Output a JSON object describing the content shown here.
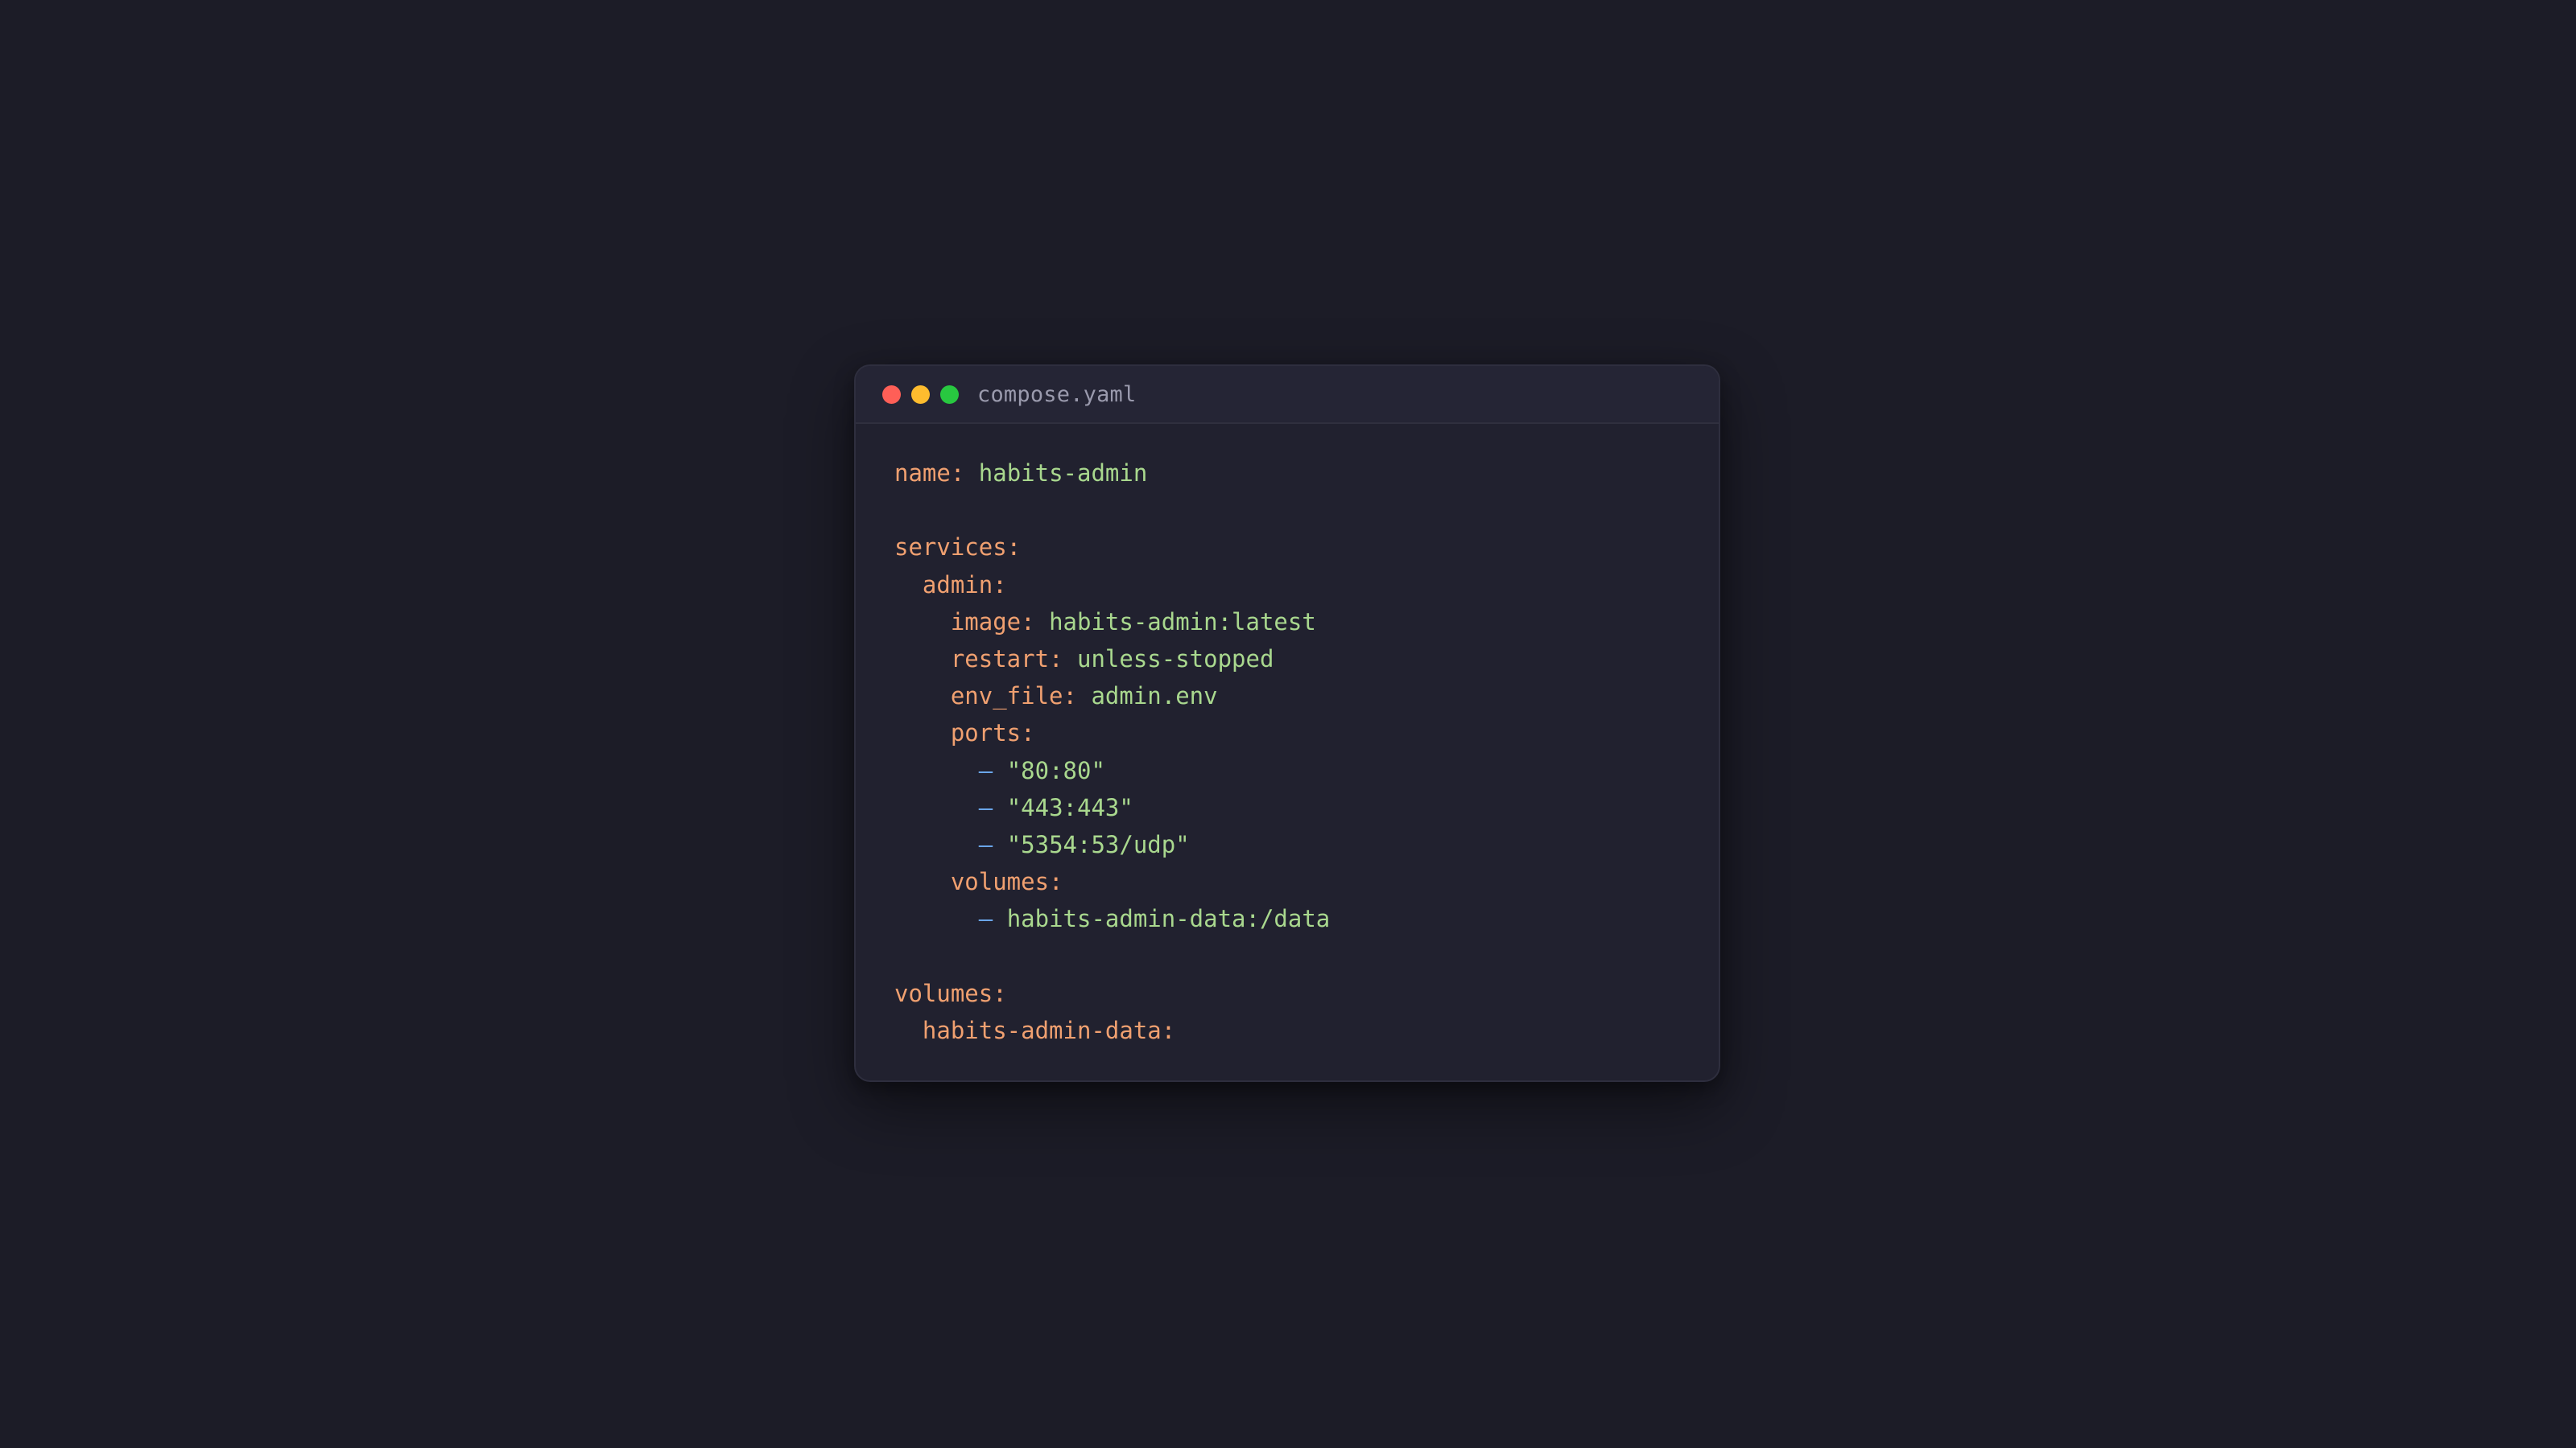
{
  "window": {
    "filename": "compose.yaml",
    "colors": {
      "background": "#1c1c27",
      "window_bg": "#21212f",
      "key": "#f0a070",
      "value": "#a9d88e",
      "dash": "#6aa6ea",
      "close": "#ff5f57",
      "minimize": "#febc2e",
      "maximize": "#28c840"
    }
  },
  "code": {
    "name_key": "name:",
    "name_val": "habits-admin",
    "services_key": "services:",
    "admin_key": "admin:",
    "image_key": "image:",
    "image_val": "habits-admin:latest",
    "restart_key": "restart:",
    "restart_val": "unless-stopped",
    "env_file_key": "env_file:",
    "env_file_val": "admin.env",
    "ports_key": "ports:",
    "port1": "\"80:80\"",
    "port2": "\"443:443\"",
    "port3": "\"5354:53/udp\"",
    "svc_volumes_key": "volumes:",
    "svc_volume1": "habits-admin-data:/data",
    "volumes_key": "volumes:",
    "volume_name_key": "habits-admin-data:",
    "dash": "–"
  }
}
